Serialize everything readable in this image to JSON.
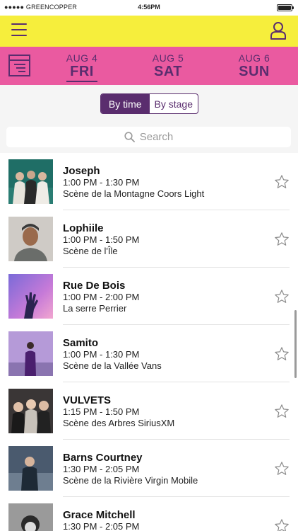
{
  "status_bar": {
    "carrier": "●●●●● GREENCOPPER",
    "time": "4:56PM",
    "battery_level": 1.0
  },
  "days": [
    {
      "date": "AUG 4",
      "dow": "FRI",
      "active": true
    },
    {
      "date": "AUG 5",
      "dow": "SAT",
      "active": false
    },
    {
      "date": "AUG 6",
      "dow": "SUN",
      "active": false
    }
  ],
  "view_toggle": {
    "by_time": "By time",
    "by_stage": "By stage",
    "selected": "by_time"
  },
  "search": {
    "placeholder": "Search"
  },
  "performances": [
    {
      "name": "Joseph",
      "time": "1:00 PM - 1:30 PM",
      "stage": "Scène de la Montagne Coors Light"
    },
    {
      "name": "Lophiile",
      "time": "1:00 PM - 1:50 PM",
      "stage": "Scène de l'Île"
    },
    {
      "name": "Rue De Bois",
      "time": "1:00 PM - 2:00 PM",
      "stage": "La serre Perrier"
    },
    {
      "name": "Samito",
      "time": "1:00 PM - 1:30 PM",
      "stage": "Scène de la Vallée Vans"
    },
    {
      "name": "VULVETS",
      "time": "1:15 PM - 1:50 PM",
      "stage": "Scène des Arbres SiriusXM"
    },
    {
      "name": "Barns Courtney",
      "time": "1:30 PM - 2:05 PM",
      "stage": "Scène de la Rivière Virgin Mobile"
    },
    {
      "name": "Grace Mitchell",
      "time": "1:30 PM - 2:05 PM",
      "stage": ""
    }
  ],
  "colors": {
    "header_yellow": "#f6ee3c",
    "day_bar_pink": "#ea5aa0",
    "accent_purple": "#5a2d6e"
  },
  "icons": {
    "menu": "hamburger-icon",
    "profile": "user-icon",
    "filter": "filter-icon",
    "search": "search-icon",
    "favorite": "star-outline-icon"
  }
}
